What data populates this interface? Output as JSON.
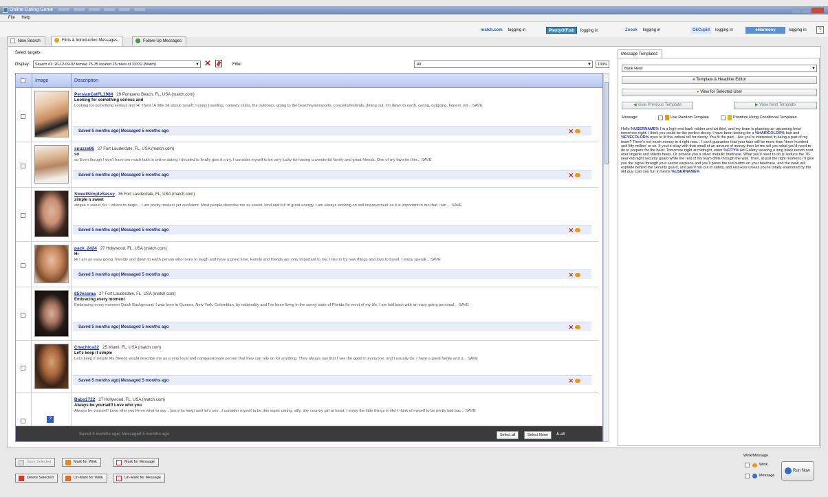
{
  "window": {
    "title": "Online Dating Genie"
  },
  "menu": {
    "file": "File",
    "help": "Help"
  },
  "tabs": [
    {
      "label": "New Search"
    },
    {
      "label": "Flirts & Introduction Messages"
    },
    {
      "label": "Follow-Up Messages"
    }
  ],
  "sites": [
    {
      "logo": "match.com",
      "status": "logging in"
    },
    {
      "logo": "PlentyOfFish",
      "status": "logging in"
    },
    {
      "logo": "Zoosk",
      "status": "logging in"
    },
    {
      "logo": "OkCupid",
      "status": "logging in"
    },
    {
      "logo": "eHarmony",
      "status": "logging in"
    }
  ],
  "targets": {
    "section_label": "Select targets",
    "display_label": "Display:",
    "display_value": "Search #1: 26-12-09-02 female 25-35 located 25 miles of 33332 (Match)",
    "filter_label": "Filter",
    "filter_value": "All",
    "zoom": "100%"
  },
  "grid": {
    "headers": {
      "image": "Image",
      "description": "Description"
    },
    "rows": [
      {
        "username": "PersianCatFL1984",
        "meta": "29 Pompano Beach, FL, USA (match.com)",
        "subject": "Looking for something serious and",
        "body": "Looking for something serious and Hi There! A little bit about myself: I enjoy traveling, comedy clubs, the outdoors, going to the beach/watersports, concerts/festivals, dining out. I'm down to earth, caring, outgoing, honest, wit... SAVE",
        "status": "Saved 5 months ago| Messaged 5 months ago"
      },
      {
        "username": "snuzze86",
        "meta": "27 Fort Lauderdale, FL, USA (match.com)",
        "subject": "so",
        "body": "so Even though I don't have too much faith in online dating I decided to finally give it a try. I consider myself to be very lucky for having a wonderful family and great friends. One of my favorite thin... SAVE",
        "status": "Saved 5 months ago| Messaged 5 months ago"
      },
      {
        "username": "SweetSimpleSassy",
        "meta": "36 Fort Lauderdale, FL, USA (match.com)",
        "subject": "simple n sweet",
        "body": "simple n sweet So ~ where to begin... I am pretty modest yet confident. Most people describe me as sweet, kind and full of great energy. I am always working on self improvement as it is important to me that I am ... SAVE",
        "status": "Saved 5 months ago| Messaged 5 months ago"
      },
      {
        "username": "pack_2424",
        "meta": "27 Hollywood, FL, USA (match.com)",
        "subject": "Hi",
        "body": "Hi I am an easy going, friendly and down to earth person who loves to laugh and have a great time. Family and friends are very important to me. I like to try new things and love to travel. I enjoy spendi... SAVE",
        "status": "Saved 5 months ago| Messaged 5 months ago"
      },
      {
        "username": "85Jessma",
        "meta": "27 Fort Lauderdale, FL, USA (match.com)",
        "subject": "Embracing every moment",
        "body": "Embracing every moment Quick Background: I was born in Queens, New York. Colombian, by nationality and I've been living in the sunny state of Florida for most of my life. I am laid back with an easy going personal... SAVE",
        "status": "Saved 5 months ago| Messaged 5 months ago"
      },
      {
        "username": "Chachica32",
        "meta": "25 Miami, FL, USA (match.com)",
        "subject": "Let's keep it simple",
        "body": "Let's keep it simple My friends would describe me as a very loyal and compassionate person that they can rely on for anything. They always say that I see the good in everyone, and I usually do. I have a great family and a... SAVE",
        "status": "Saved 5 months ago| Messaged 5 months ago"
      },
      {
        "username": "Babs1722",
        "meta": "27 Hollywood, FL, USA (match.com)",
        "subject": "Always be yourself! Love who you",
        "body": "Always be yourself! Love who you Hmm what to say ..(sorry its long) well let's see ..I consider myself to be this super caring, silly, shy country girl at heart. I enjoy the little things in life! I think of myself to be pretty laid bac... SAVE",
        "status": "Saved 5 months ago| Messaged 5 months ago"
      }
    ],
    "footer": {
      "status": "Saved 5 months ago| Messaged 5 months ago",
      "select_all": "Select all",
      "select_none": "Select None",
      "extra": "&.all"
    }
  },
  "templates": {
    "tab": "Message Templates",
    "select_value": "Bank Heist",
    "editor_button": "Template & Headline Editor",
    "view_user_button": "View for Selected User",
    "prev_button": "View Previous Template",
    "next_button": "View Next Template",
    "message_label": "Message:",
    "random_label": "Use Random Template",
    "prioritize_label": "Prioritize Using Conditional Templates",
    "message_parts": [
      {
        "t": "Hello ",
        "hl": false
      },
      {
        "t": "%USERNAME%",
        "hl": true
      },
      {
        "t": " I'm a high-end bank robber and art thief, and my team is planning an upcoming heist tomorrow night. I think you could be the perfect decoy. I have been looking for a ",
        "hl": false
      },
      {
        "t": "%HAIRCOLOR%",
        "hl": true
      },
      {
        "t": " hair and ",
        "hl": false
      },
      {
        "t": "%EYECOLOR%",
        "hl": true
      },
      {
        "t": " eyes to fit this critical roll for decoy. You fit the part... Are you're interested in being a part of my team? There's not much money in it right now... I can't guarantee that your take will be more than 'three hundred and fifty million' or so. If you're okay with that small of an amount of money then let me tell you what you'd need to do to prepare for the heist. Tomorrow night at midnight, enter ",
        "hl": false
      },
      {
        "t": "%CITY%",
        "hl": true
      },
      {
        "t": " Art Gallery wearing a long black trench coat over lingerie and stiletto heels. Or provide you a silver metallic briefcase. What you'll need to do is seduce the 76-year old night security guard while the rest of my team drills through the wall. Then, at just the right moment, I'll give you the signal through your secret earpiece and you'll press the red button on your briefcase, and the vault will explode behind the security guard, and you'll run out to safety, and kiss-kiss unless you're totally enamored by the old guy. Can you fun in heists ",
        "hl": false
      },
      {
        "t": "%USERNAME%",
        "hl": true
      }
    ]
  },
  "bottom": {
    "save_selected": "Save Selected",
    "delete_selected": "Delete Selected",
    "mark_wink": "Mark for Wink",
    "unmark_wink": "Un-Mark for Wink",
    "mark_message": "Mark for Message",
    "unmark_message": "Un-Mark for Message",
    "wink_message_label": "Wink/Message",
    "wink_label": "Wink",
    "message_label": "Message",
    "run_now": "Run Now"
  }
}
